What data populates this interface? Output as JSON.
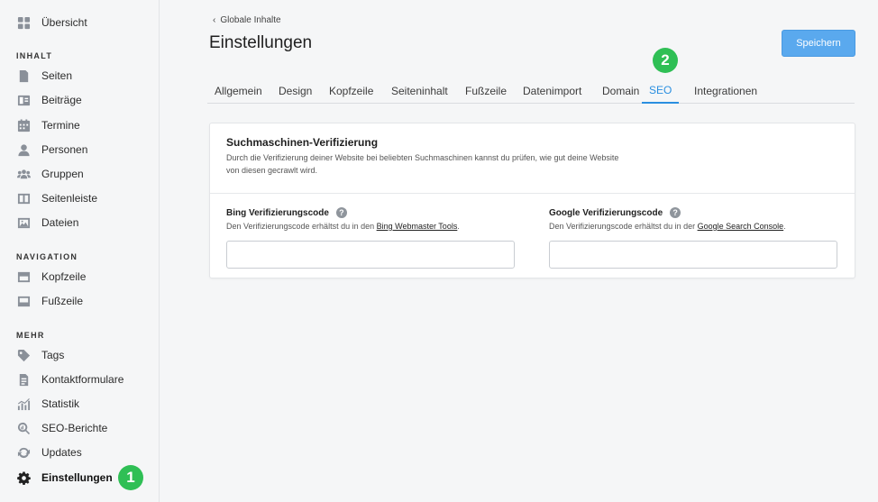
{
  "sidebar": {
    "overview": "Übersicht",
    "sections": {
      "content": "INHALT",
      "navigation": "NAVIGATION",
      "more": "MEHR"
    },
    "content_items": [
      "Seiten",
      "Beiträge",
      "Termine",
      "Personen",
      "Gruppen",
      "Seitenleiste",
      "Dateien"
    ],
    "navigation_items": [
      "Kopfzeile",
      "Fußzeile"
    ],
    "more_items": [
      "Tags",
      "Kontaktformulare",
      "Statistik",
      "SEO-Berichte",
      "Updates",
      "Einstellungen"
    ],
    "active_item": "Einstellungen"
  },
  "badges": [
    "1",
    "2"
  ],
  "header": {
    "breadcrumb": "Globale Inhalte",
    "title": "Einstellungen",
    "save_label": "Speichern"
  },
  "tabs": [
    "Allgemein",
    "Design",
    "Kopfzeile",
    "Seiteninhalt",
    "Fußzeile",
    "Datenimport",
    "Domain",
    "SEO",
    "Integrationen"
  ],
  "active_tab": "SEO",
  "card": {
    "title": "Suchmaschinen-Verifizierung",
    "description_line1": "Durch die Verifizierung deiner Website bei beliebten Suchmaschinen kannst du prüfen, wie gut deine Website",
    "description_line2": "von diesen gecrawlt wird.",
    "bing": {
      "label": "Bing Verifizierungscode",
      "desc_prefix": "Den Verifizierungscode erhältst du in den ",
      "link": "Bing Webmaster Tools",
      "desc_suffix": ".",
      "value": ""
    },
    "google": {
      "label": "Google Verifizierungscode",
      "desc_prefix": "Den Verifizierungscode erhältst du in der ",
      "link": "Google Search Console",
      "desc_suffix": ".",
      "value": ""
    }
  },
  "colors": {
    "accent": "#2a8fe0",
    "save_button": "#5aa9ee",
    "badge": "#2fbf55"
  }
}
